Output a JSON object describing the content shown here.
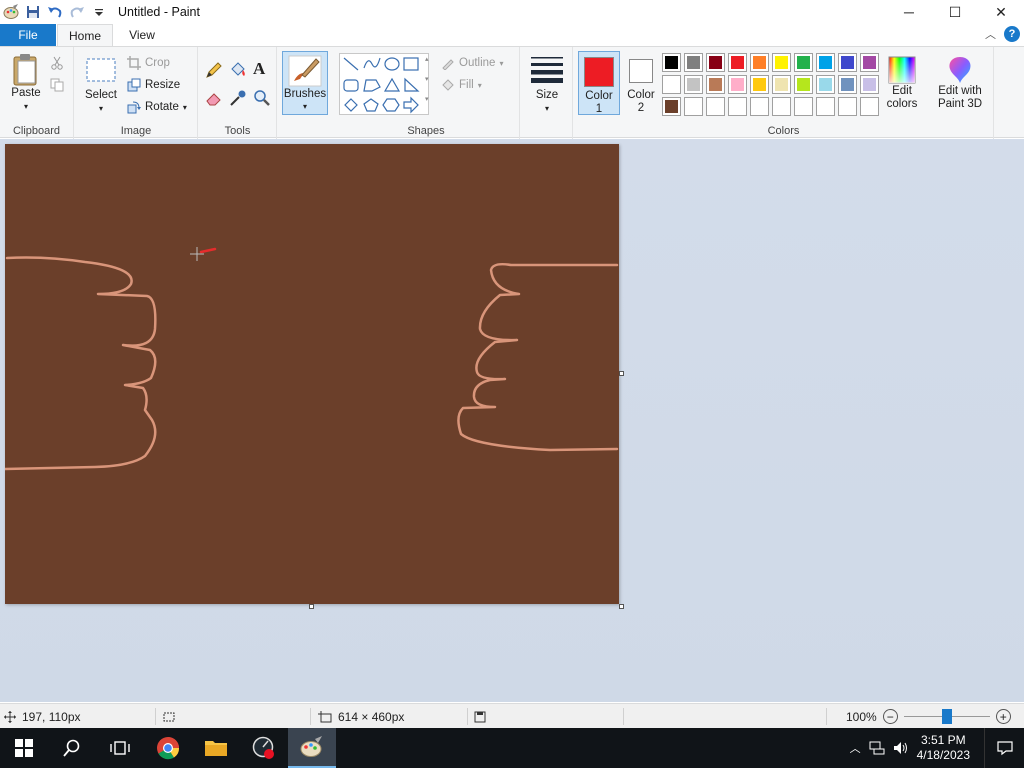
{
  "window": {
    "title": "Untitled - Paint",
    "min_label": "─",
    "max_label": "☐",
    "close_label": "✕"
  },
  "tabs": {
    "file": "File",
    "home": "Home",
    "view": "View",
    "help": "?"
  },
  "clipboard": {
    "paste": "Paste",
    "label": "Clipboard"
  },
  "image": {
    "select": "Select",
    "crop": "Crop",
    "resize": "Resize",
    "rotate": "Rotate",
    "label": "Image"
  },
  "tools": {
    "label": "Tools"
  },
  "brushes": {
    "label": "Brushes"
  },
  "shapes": {
    "outline": "Outline",
    "fill": "Fill",
    "label": "Shapes"
  },
  "size": {
    "label": "Size"
  },
  "colors": {
    "color1_label": "Color",
    "color1_num": "1",
    "color2_label": "Color",
    "color2_num": "2",
    "color1": "#ed1c24",
    "color2": "#ffffff",
    "edit_colors_1": "Edit",
    "edit_colors_2": "colors",
    "label": "Colors",
    "palette_row1": [
      "#000000",
      "#7f7f7f",
      "#880015",
      "#ed1c24",
      "#ff7f27",
      "#fff200",
      "#22b14c",
      "#00a2e8",
      "#3f48cc",
      "#a349a4"
    ],
    "palette_row2": [
      "#ffffff",
      "#c3c3c3",
      "#b97a57",
      "#ffaec9",
      "#ffc90e",
      "#efe4b0",
      "#b5e61d",
      "#99d9ea",
      "#7092be",
      "#c8bfe7"
    ],
    "palette_row3": [
      "#6b3f2a",
      "#ffffff",
      "#ffffff",
      "#ffffff",
      "#ffffff",
      "#ffffff",
      "#ffffff",
      "#ffffff",
      "#ffffff",
      "#ffffff"
    ]
  },
  "paint3d": {
    "line1": "Edit with",
    "line2": "Paint 3D"
  },
  "canvas": {
    "background": "#6b3f2a",
    "stroke": "#d9957a"
  },
  "status": {
    "cursor_pos": "197, 110px",
    "image_size": "614 × 460px",
    "zoom": "100%",
    "zoom_fraction": 0.5
  },
  "taskbar": {
    "time": "3:51 PM",
    "date": "4/18/2023"
  }
}
